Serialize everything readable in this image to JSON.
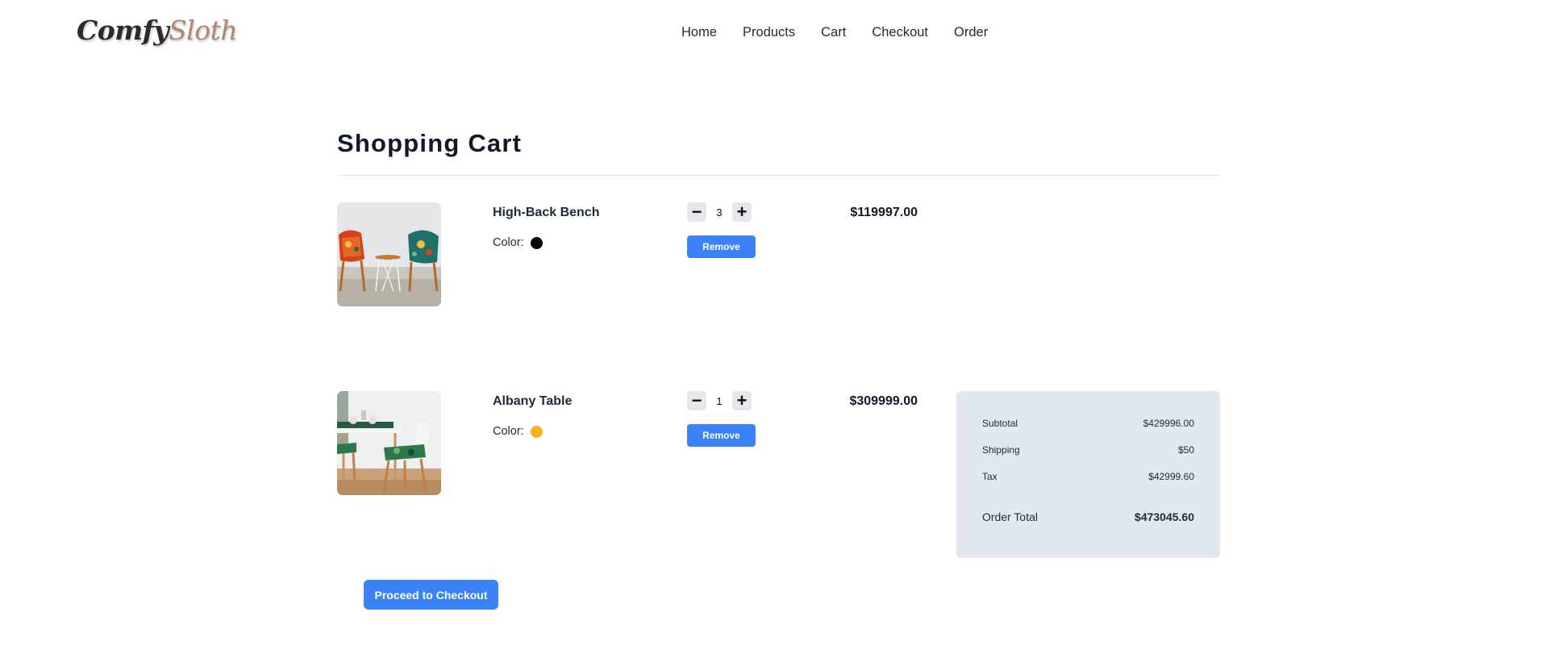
{
  "brand": {
    "part1": "Comfy",
    "part2": "Sloth"
  },
  "nav": {
    "items": [
      {
        "label": "Home"
      },
      {
        "label": "Products"
      },
      {
        "label": "Cart"
      },
      {
        "label": "Checkout"
      },
      {
        "label": "Order"
      }
    ]
  },
  "page": {
    "title": "Shopping Cart"
  },
  "cart": {
    "color_label": "Color:",
    "remove_label": "Remove",
    "items": [
      {
        "name": "High-Back Bench",
        "color": "#000000",
        "quantity": "3",
        "price": "$119997.00",
        "image": "chairs-photo"
      },
      {
        "name": "Albany Table",
        "color": "#f5b21b",
        "quantity": "1",
        "price": "$309999.00",
        "image": "dining-table-photo"
      }
    ]
  },
  "summary": {
    "subtotal_label": "Subtotal",
    "subtotal_value": "$429996.00",
    "shipping_label": "Shipping",
    "shipping_value": "$50",
    "tax_label": "Tax",
    "tax_value": "$42999.60",
    "total_label": "Order Total",
    "total_value": "$473045.60"
  },
  "checkout_button": "Proceed to Checkout",
  "colors": {
    "accent": "#3b82f6",
    "summary_bg": "#e2e8f0",
    "logo_accent": "#b5856e"
  }
}
